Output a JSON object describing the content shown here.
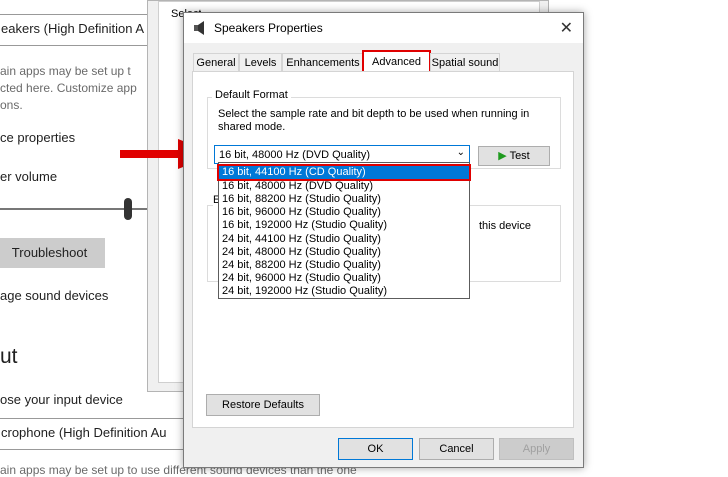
{
  "background_page": {
    "output_device_value": "eakers (High Definition A",
    "apps_note_line1": "ain apps may be set up t",
    "apps_note_line2": "cted here. Customize app",
    "apps_note_line3": "ons.",
    "device_properties_link": "ce properties",
    "volume_label": "er volume",
    "troubleshoot_button": "Troubleshoot",
    "manage_devices_link": "age sound devices",
    "input_heading": "ut",
    "choose_input_label": "ose your input device",
    "input_device_value": "crophone (High Definition Au",
    "bottom_note": "ain apps may be set up to use different sound devices than the one"
  },
  "back_dialog": {
    "partial_text": "Select a playback device below to modify its settings:"
  },
  "dialog": {
    "title": "Speakers Properties",
    "tabs": [
      {
        "label": "General",
        "active": false
      },
      {
        "label": "Levels",
        "active": false
      },
      {
        "label": "Enhancements",
        "active": false
      },
      {
        "label": "Advanced",
        "active": true
      },
      {
        "label": "Spatial sound",
        "active": false
      }
    ],
    "default_format": {
      "group_label": "Default Format",
      "description": "Select the sample rate and bit depth to be used when running in shared mode.",
      "selected_value": "16 bit, 48000 Hz (DVD Quality)",
      "test_button": "Test",
      "options": [
        {
          "label": "16 bit, 44100 Hz (CD Quality)",
          "highlighted": true
        },
        {
          "label": "16 bit, 48000 Hz (DVD Quality)",
          "highlighted": false
        },
        {
          "label": "16 bit, 88200 Hz (Studio Quality)",
          "highlighted": false
        },
        {
          "label": "16 bit, 96000 Hz (Studio Quality)",
          "highlighted": false
        },
        {
          "label": "16 bit, 192000 Hz (Studio Quality)",
          "highlighted": false
        },
        {
          "label": "24 bit, 44100 Hz (Studio Quality)",
          "highlighted": false
        },
        {
          "label": "24 bit, 48000 Hz (Studio Quality)",
          "highlighted": false
        },
        {
          "label": "24 bit, 88200 Hz (Studio Quality)",
          "highlighted": false
        },
        {
          "label": "24 bit, 96000 Hz (Studio Quality)",
          "highlighted": false
        },
        {
          "label": "24 bit, 192000 Hz (Studio Quality)",
          "highlighted": false
        }
      ]
    },
    "exclusive_mode_partial": "this device",
    "restore_defaults_button": "Restore Defaults",
    "ok_button": "OK",
    "cancel_button": "Cancel",
    "apply_button": "Apply"
  },
  "colors": {
    "highlight_red": "#e00000",
    "selection_blue": "#0078d7"
  }
}
